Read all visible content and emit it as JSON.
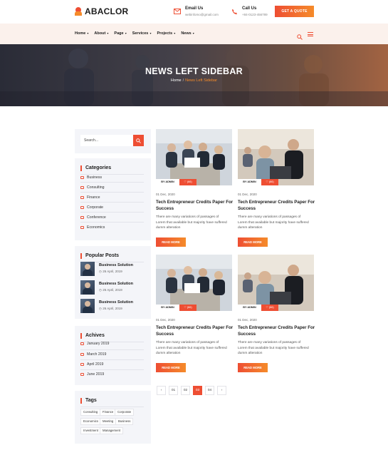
{
  "brand": {
    "name": "ABACLOR",
    "accent": "#ee4e33",
    "accent2": "#f58b2a"
  },
  "header": {
    "email_label": "Email Us",
    "email_value": "webinfomo@gmail.com",
    "call_label": "Call Us",
    "call_value": "+84-0123-456789",
    "quote_button": "GET A QUOTE"
  },
  "nav": {
    "items": [
      {
        "label": "Home"
      },
      {
        "label": "About"
      },
      {
        "label": "Page"
      },
      {
        "label": "Services"
      },
      {
        "label": "Projects"
      },
      {
        "label": "News"
      }
    ],
    "search_icon": "search-icon",
    "menu_icon": "hamburger-icon"
  },
  "hero": {
    "title": "NEWS LEFT SIDEBAR",
    "breadcrumb_home": "Home",
    "breadcrumb_sep": "/",
    "breadcrumb_current": "News Left Sidebar"
  },
  "sidebar": {
    "search_placeholder": "Search...",
    "categories_title": "Categories",
    "categories": [
      "Business",
      "Consulting",
      "Finance",
      "Corporate",
      "Conference",
      "Economics"
    ],
    "posts_title": "Popular Posts",
    "posts": [
      {
        "title": "Business Solution",
        "date": "26 April, 2019"
      },
      {
        "title": "Business Solution",
        "date": "26 April, 2019"
      },
      {
        "title": "Business Solution",
        "date": "26 April, 2019"
      }
    ],
    "archives_title": "Achives",
    "archives": [
      "January 2019",
      "March 2019",
      "April 2019",
      "June 2019"
    ],
    "tags_title": "Tags",
    "tags": [
      "Consulting",
      "Finance",
      "Corporate",
      "Economics",
      "Meeting",
      "Business",
      "Investment",
      "Management"
    ]
  },
  "posts": [
    {
      "by": "BY ADMIN",
      "likes": "(66)",
      "date": "01 Dec, 2020",
      "title": "Tech Entrepreneur Credits Paper For Success",
      "excerpt": "There are many variations of passages of Lorem that available but majority have suffered dumm alteration",
      "more": "READ MORE"
    },
    {
      "by": "BY ADMIN",
      "likes": "(66)",
      "date": "01 Dec, 2020",
      "title": "Tech Entrepreneur Credits Paper For Success",
      "excerpt": "There are many variations of passages of Lorem that available but majority have suffered dumm alteration",
      "more": "READ MORE"
    },
    {
      "by": "BY ADMIN",
      "likes": "(66)",
      "date": "01 Dec, 2020",
      "title": "Tech Entrepreneur Credits Paper For Success",
      "excerpt": "There are many variations of passages of Lorem that available but majority have suffered dumm alteration",
      "more": "READ MORE"
    },
    {
      "by": "BY ADMIN",
      "likes": "(66)",
      "date": "01 Dec, 2020",
      "title": "Tech Entrepreneur Credits Paper For Success",
      "excerpt": "There are many variations of passages of Lorem that available but majority have suffered dumm alteration",
      "more": "READ MORE"
    }
  ],
  "pagination": {
    "prev": "‹",
    "pages": [
      "01",
      "02",
      "03",
      "04"
    ],
    "active": "03",
    "next": "›"
  }
}
